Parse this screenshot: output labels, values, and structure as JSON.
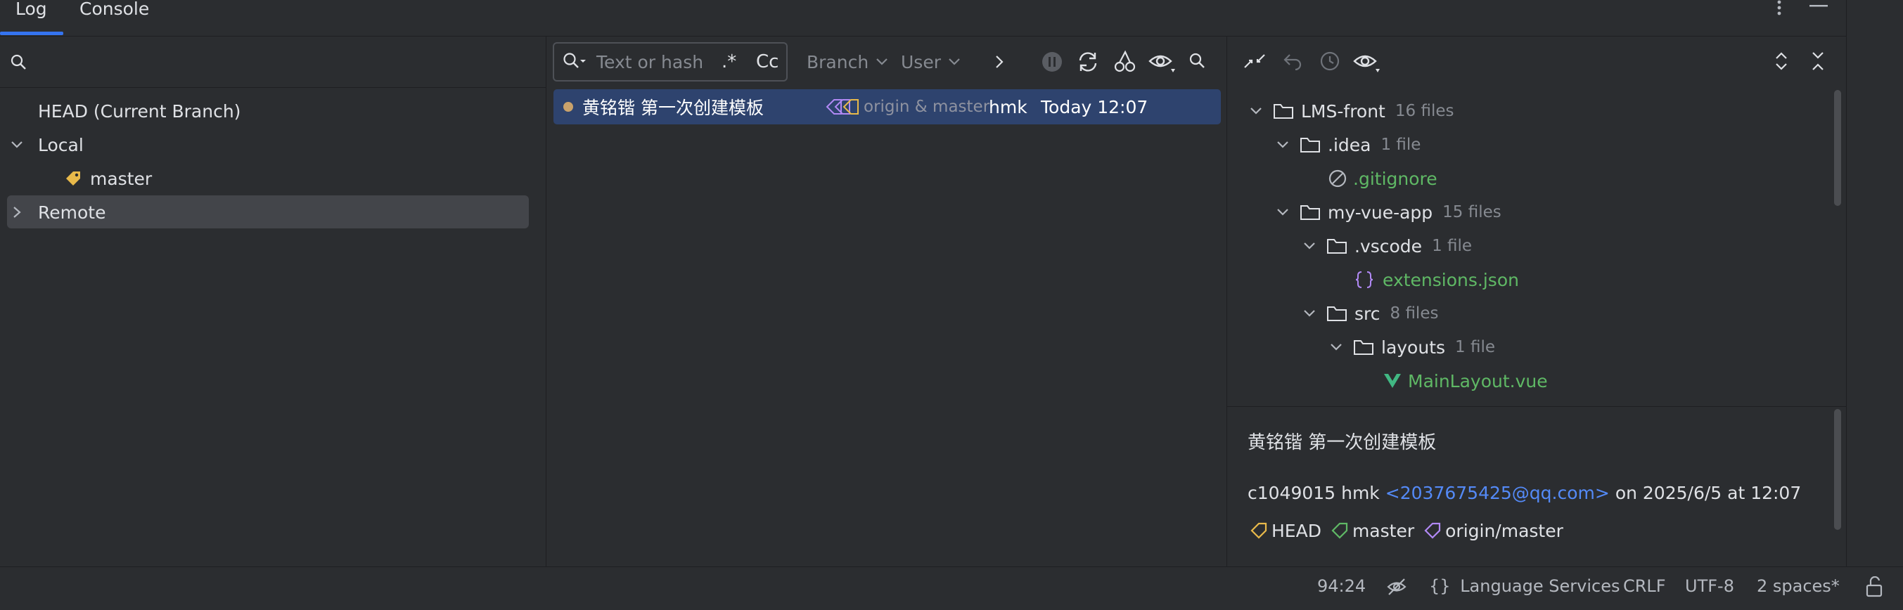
{
  "tabs": {
    "log": "Log",
    "console": "Console"
  },
  "branches": {
    "head": "HEAD (Current Branch)",
    "local": "Local",
    "master": "master",
    "remote": "Remote"
  },
  "log_toolbar": {
    "filter_placeholder": "Text or hash",
    "regex": ".*",
    "case": "Cc",
    "branch": "Branch",
    "user": "User"
  },
  "commit": {
    "message": "黄铭锴 第一次创建模板",
    "refs": "origin & master",
    "author": "hmk",
    "date": "Today 12:07"
  },
  "changes_tree": {
    "root": {
      "name": "LMS-front",
      "count": "16 files"
    },
    "idea": {
      "name": ".idea",
      "count": "1 file"
    },
    "gitignore": ".gitignore",
    "app": {
      "name": "my-vue-app",
      "count": "15 files"
    },
    "vscode": {
      "name": ".vscode",
      "count": "1 file"
    },
    "extensions": "extensions.json",
    "src": {
      "name": "src",
      "count": "8 files"
    },
    "layouts": {
      "name": "layouts",
      "count": "1 file"
    },
    "mainlayout": "MainLayout.vue"
  },
  "details": {
    "subject": "黄铭锴  第一次创建模板",
    "hash": "c1049015",
    "author": "hmk",
    "email": "<2037675425@qq.com>",
    "on": "on 2025/6/5 at 12:07",
    "tags": [
      "HEAD",
      "master",
      "origin/master"
    ]
  },
  "status_bar": {
    "position": "94:24",
    "language_services": "Language Services",
    "line_ending": "CRLF",
    "encoding": "UTF-8",
    "indent": "2 spaces*"
  },
  "colors": {
    "accent": "#3574f0",
    "selection": "#2e436e",
    "tag_yellow": "#e8b94a",
    "tag_green": "#5fb865",
    "tag_purple": "#b189f5",
    "vue_green": "#41b883"
  }
}
